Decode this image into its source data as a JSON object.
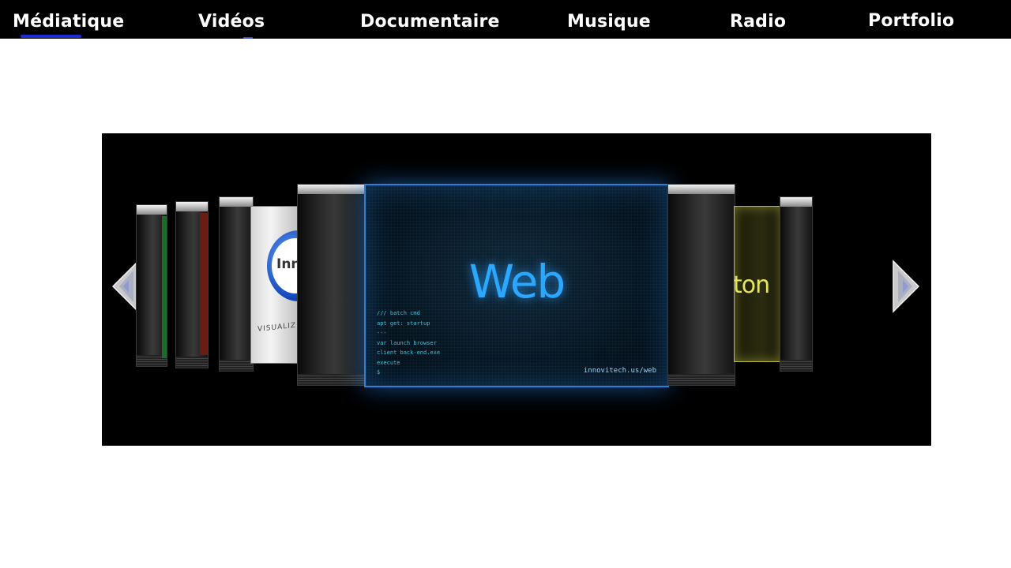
{
  "nav": {
    "items": [
      {
        "label": "Médiatique",
        "active": true
      },
      {
        "label": "Vidéos"
      },
      {
        "label": "Documentaire"
      },
      {
        "label": "Musique"
      },
      {
        "label": "Radio"
      },
      {
        "label": "Portfolio"
      }
    ],
    "active_color": "#1c2bd6"
  },
  "carousel": {
    "prev_icon": "chevron-left-icon",
    "next_icon": "chevron-right-icon",
    "current": {
      "title": "Web",
      "code_lines": [
        "/// batch cmd",
        "apt get: startup",
        "---",
        "var launch browser",
        "client back-end.exe",
        "execute",
        "$"
      ],
      "url": "innovitech.us/web"
    },
    "left_cards": [
      {
        "label": "Inno"
      },
      {
        "label": "VISUALIZE"
      }
    ],
    "right_cards": [
      {
        "label": "ton"
      }
    ],
    "accent_color": "#2aa8ff"
  }
}
